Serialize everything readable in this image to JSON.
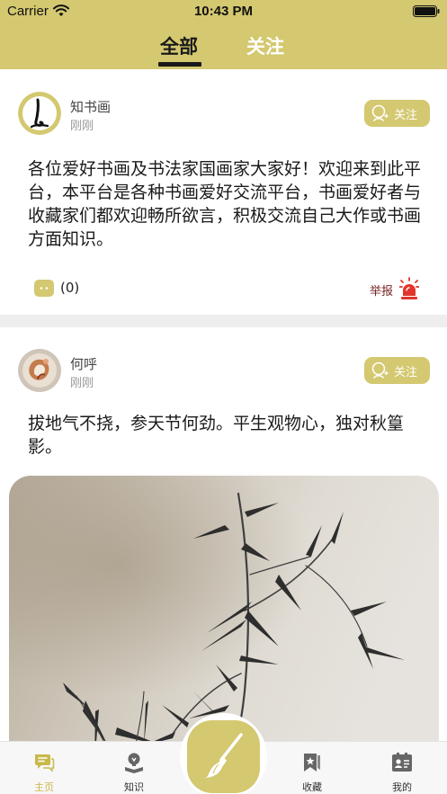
{
  "status_bar": {
    "carrier": "Carrier",
    "time": "10:43 PM"
  },
  "tabs": [
    {
      "label": "全部",
      "active": true
    },
    {
      "label": "关注",
      "active": false
    }
  ],
  "posts": [
    {
      "author": "知书画",
      "time": "刚刚",
      "follow_label": "关注",
      "content": "各位爱好书画及书法家国画家大家好！欢迎来到此平台，本平台是各种书画爱好交流平台，书画爱好者与收藏家们都欢迎畅所欲言，积极交流自己大作或书画方面知识。",
      "comment_count": "(0)",
      "report_label": "举报"
    },
    {
      "author": "何呼",
      "time": "刚刚",
      "follow_label": "关注",
      "content": "拔地气不挠，参天节何劲。平生观物心，独对秋篁影。"
    }
  ],
  "bottom_nav": [
    {
      "label": "主页",
      "icon": "chat-bubble-icon",
      "active": true
    },
    {
      "label": "知识",
      "icon": "lightbulb-book-icon",
      "active": false
    },
    {
      "label": "收藏",
      "icon": "bookmark-star-icon",
      "active": false
    },
    {
      "label": "我的",
      "icon": "profile-card-icon",
      "active": false
    }
  ],
  "publish_icon": "brush-icon",
  "colors": {
    "accent": "#d4c870",
    "active_nav": "#c9b84a",
    "report": "#7a2525",
    "alarm": "#e0352b"
  }
}
